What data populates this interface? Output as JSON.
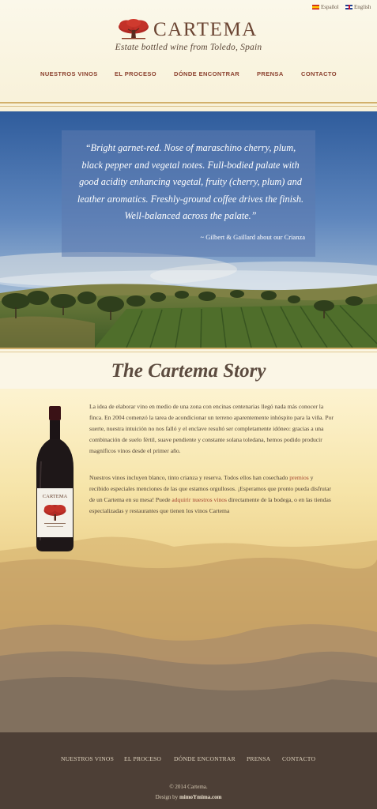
{
  "header": {
    "languages": [
      {
        "label": "Español",
        "flag": "spain-flag-icon"
      },
      {
        "label": "English",
        "flag": "uk-flag-icon"
      }
    ],
    "brand": "CARTEMA",
    "tagline": "Estate bottled wine from Toledo, Spain",
    "nav": [
      "NUESTROS VINOS",
      "EL PROCESO",
      "DÓNDE ENCONTRAR",
      "PRENSA",
      "CONTACTO"
    ]
  },
  "hero": {
    "quote": "“Bright garnet-red. Nose of maraschino cherry, plum, black pepper and vegetal notes. Full-bodied palate with good acidity enhancing vegetal, fruity (cherry, plum) and leather aromatics. Freshly-ground coffee drives the finish. Well-balanced across the palate.”",
    "source": "~ Gilbert & Gaillard about our Crianza"
  },
  "story": {
    "title": "The Cartema Story",
    "paragraph1": "La idea de elaborar vino en medio de una zona con encinas centenarias llegó nada más conocer la finca. En 2004 comenzó la tarea de acondicionar un terreno aparentemente inhóspito para la viña. Por suerte, nuestra intuición no nos falló y el enclave resultó ser completamente idóneo: gracias a una combinación de suelo fértil, suave pendiente y constante solana toledana, hemos podido producir magníficos vinos desde el primer año.",
    "p2_a": "Nuestros vinos incluyen blanco, tinto crianza y reserva. Todos ellos han cosechado ",
    "p2_link1": "premios",
    "p2_b": " y recibido especiales menciones de las que estamos orgullosos. ¡Esperamos que pronto pueda disfrutar de un Cartema en su mesa! Puede ",
    "p2_link2": "adquirir nuestros vinos",
    "p2_c": " directamente de la bodega, o en las tiendas especializadas y restaurantes que tienen los vinos Cartema",
    "bottle_label": "CARTEMA"
  },
  "footer": {
    "nav": [
      "NUESTROS VINOS",
      "EL PROCESO",
      "DÓNDE ENCONTRAR",
      "PRENSA",
      "CONTACTO"
    ],
    "copyright": "© 2014 Cartema.",
    "design_prefix": "Design by ",
    "designer": "mimoYmima.com"
  },
  "colors": {
    "brand_brown": "#6b4533",
    "nav_red": "#8a3f2c",
    "footer_bg": "#4d3f36",
    "quote_box": "#5c7aaf"
  }
}
